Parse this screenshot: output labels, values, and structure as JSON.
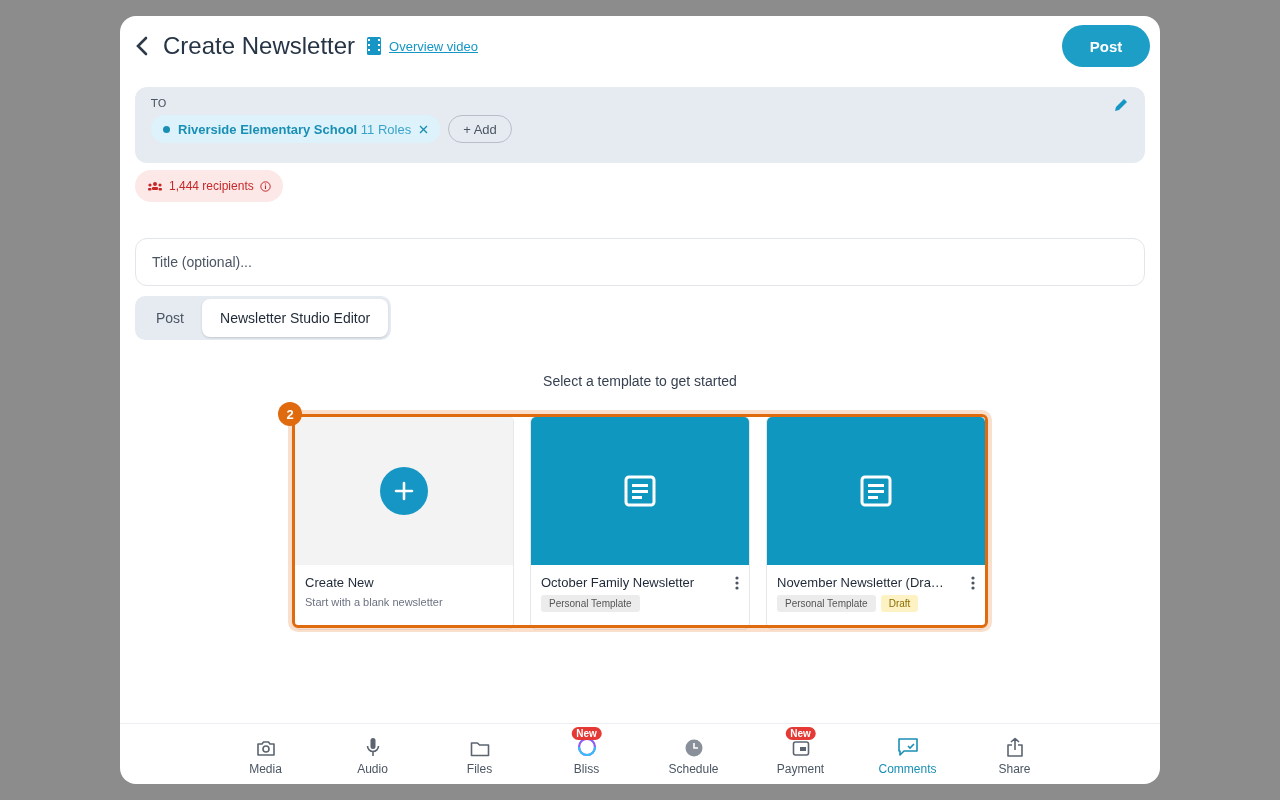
{
  "header": {
    "title": "Create Newsletter",
    "video_link": "Overview video",
    "post_button": "Post"
  },
  "recipients": {
    "label": "TO",
    "chips": [
      {
        "name": "Riverside Elementary School",
        "detail": "11 Roles"
      }
    ],
    "add_button": "+ Add",
    "count": "1,444 recipients"
  },
  "title_field": {
    "placeholder": "Title (optional)..."
  },
  "tabs": [
    {
      "label": "Post",
      "selected": false
    },
    {
      "label": "Newsletter Studio Editor",
      "selected": true
    }
  ],
  "template_prompt": "Select a template to get started",
  "highlight": {
    "label": "2"
  },
  "templates": [
    {
      "kind": "new",
      "title": "Create New",
      "subtitle": "Start with a blank newsletter"
    },
    {
      "kind": "template",
      "title": "October Family Newsletter",
      "tags": [
        {
          "label": "Personal Template",
          "kind": "plain"
        }
      ]
    },
    {
      "kind": "template",
      "title": "November Newsletter (Dra…",
      "tags": [
        {
          "label": "Personal Template",
          "kind": "plain"
        },
        {
          "label": "Draft",
          "kind": "draft"
        }
      ]
    }
  ],
  "toolbar": [
    {
      "kind": "camera",
      "label": "Media",
      "selected": false
    },
    {
      "kind": "mic",
      "label": "Audio",
      "selected": false
    },
    {
      "kind": "folder",
      "label": "Files",
      "selected": false
    },
    {
      "kind": "ring",
      "label": "Bliss",
      "selected": false,
      "badge": "New"
    },
    {
      "kind": "clock",
      "label": "Schedule",
      "selected": false
    },
    {
      "kind": "wallet",
      "label": "Payment",
      "selected": false,
      "badge": "New"
    },
    {
      "kind": "comment",
      "label": "Comments",
      "selected": true
    },
    {
      "kind": "share",
      "label": "Share",
      "selected": false
    }
  ]
}
